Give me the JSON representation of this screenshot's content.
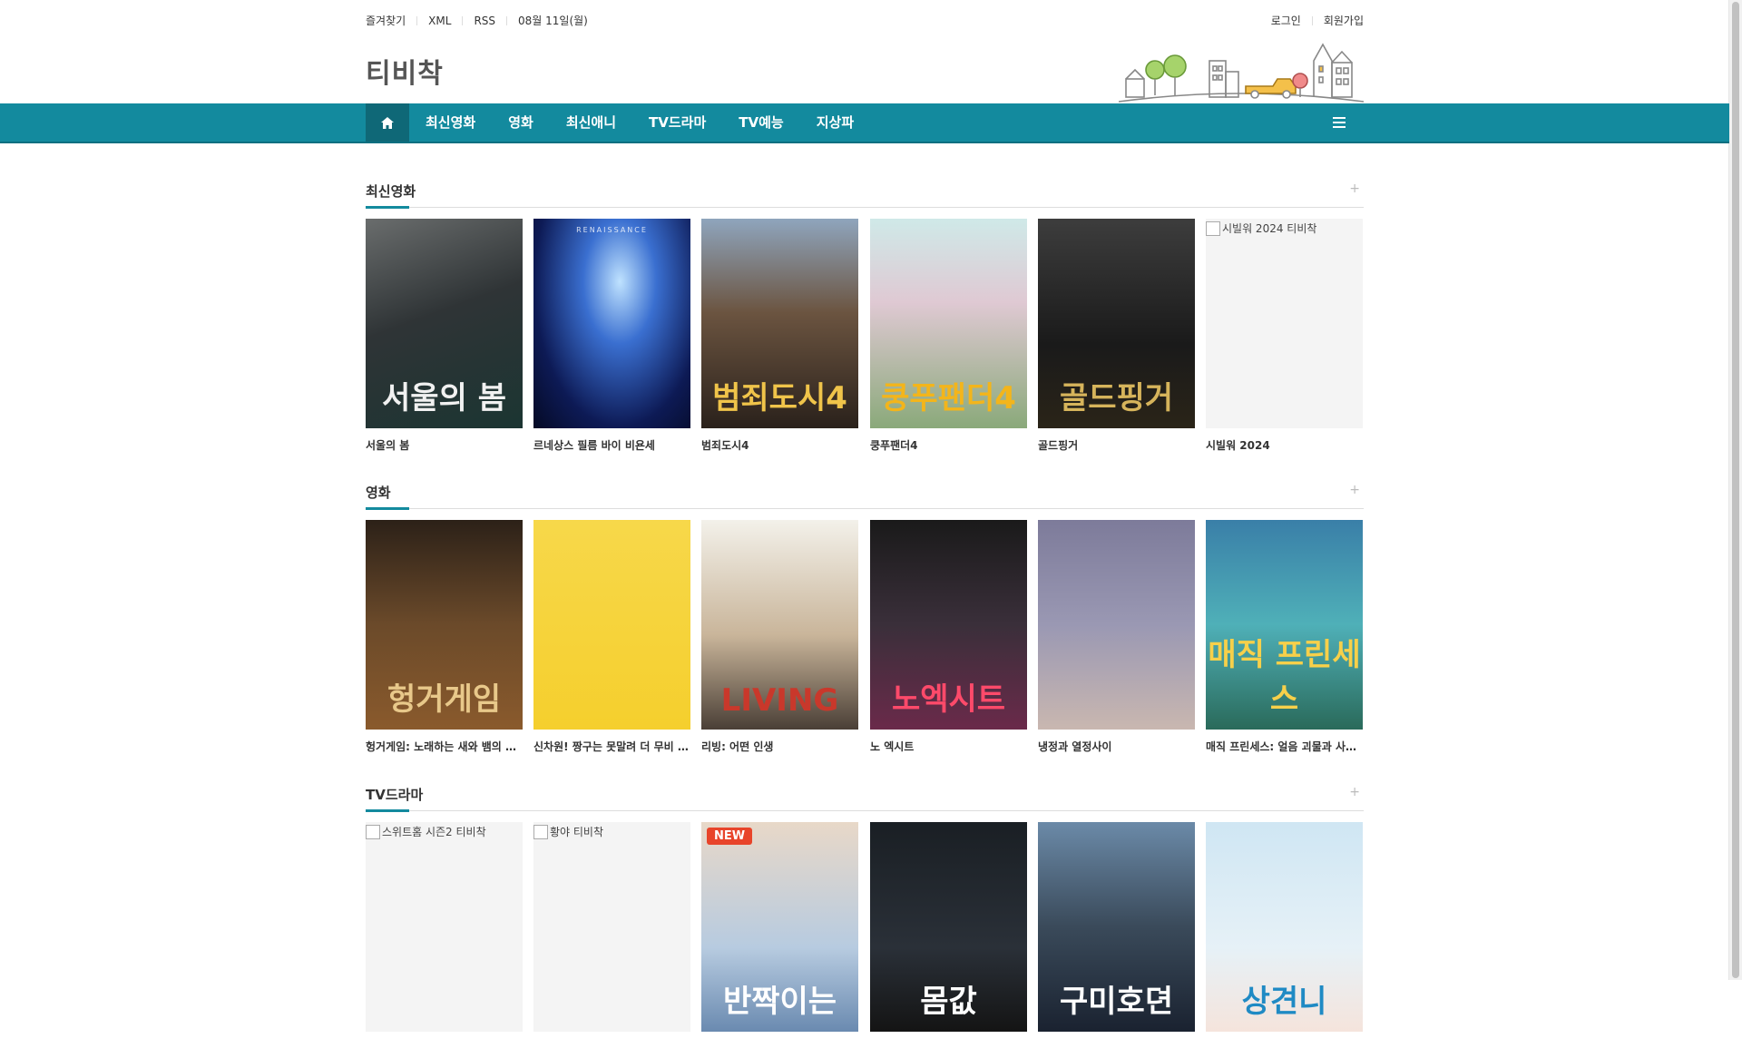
{
  "topbar": {
    "favorites": "즐겨찾기",
    "xml": "XML",
    "rss": "RSS",
    "date": "08월 11일(월)",
    "login": "로그인",
    "signup": "회원가입"
  },
  "site": {
    "logo": "티비착"
  },
  "nav": {
    "items": [
      {
        "label": "최신영화"
      },
      {
        "label": "영화"
      },
      {
        "label": "최신애니"
      },
      {
        "label": "TV드라마"
      },
      {
        "label": "TV예능"
      },
      {
        "label": "지상파"
      }
    ],
    "home_icon": "home-icon",
    "menu_icon": "hamburger-menu-icon"
  },
  "colors": {
    "accent": "#138a9e",
    "accent_dark": "#0f6877"
  },
  "sections": [
    {
      "title": "최신영화",
      "more": "+",
      "cards": [
        {
          "title": "서울의 봄",
          "poster_text": "서울의 봄",
          "alt": "",
          "bg": "linear-gradient(160deg,#6a6d6d 0%,#2f3436 45%,#1b3532 100%)",
          "fg": "#f1f1f1"
        },
        {
          "title": "르네상스 필름 바이 비욘세",
          "poster_text": "",
          "alt": "",
          "bg": "radial-gradient(ellipse at 55% 30%,#bfe2ff 0%,#3a6fd0 30%,#0d1a55 70%,#050a25 100%)",
          "fg": "#fff",
          "tag": "RENAISSANCE"
        },
        {
          "title": "범죄도시4",
          "poster_text": "범죄도시4",
          "alt": "",
          "bg": "linear-gradient(180deg,#8fa5bd 0%,#6b5440 45%,#2a211b 100%)",
          "fg": "#f0c44a"
        },
        {
          "title": "쿵푸팬더4",
          "poster_text": "쿵푸팬더4",
          "alt": "",
          "bg": "linear-gradient(180deg,#cfe9e8 0%,#dfc9d3 40%,#8aa97a 100%)",
          "fg": "#f3b51b"
        },
        {
          "title": "골드핑거",
          "poster_text": "골드핑거",
          "alt": "",
          "bg": "linear-gradient(180deg,#3d3d3d 0%,#1a1a1a 60%,#2a2418 100%)",
          "fg": "#d6b45b"
        },
        {
          "title": "시빌워 2024",
          "poster_text": "",
          "alt": "시빌워 2024 티비착",
          "bg": "#f4f4f4",
          "fg": "#333"
        }
      ]
    },
    {
      "title": "영화",
      "more": "+",
      "cards": [
        {
          "title": "헝거게임: 노래하는 새와 뱀의 발라드",
          "poster_text": "헝거게임",
          "alt": "",
          "bg": "linear-gradient(180deg,#2c2118 0%,#6b4a2a 50%,#8a5a2c 100%)",
          "fg": "#e8c88a"
        },
        {
          "title": "신차원! 짱구는 못말려 더 무비 초능력 대결전",
          "poster_text": "",
          "alt": "",
          "bg": "linear-gradient(180deg,#f7d84a 0%,#f5cf2d 100%)",
          "fg": "#333"
        },
        {
          "title": "리빙: 어떤 인생",
          "poster_text": "LIVING",
          "alt": "",
          "bg": "linear-gradient(180deg,#f3f1ea 0%,#c9b59a 55%,#4a3f36 100%)",
          "fg": "#c9382b"
        },
        {
          "title": "노 엑시트",
          "poster_text": "노엑시트",
          "alt": "",
          "bg": "linear-gradient(180deg,#1a1a1a 0%,#3a2f3a 50%,#6a2a4a 100%)",
          "fg": "#ff4a6a"
        },
        {
          "title": "냉정과 열정사이",
          "poster_text": "",
          "alt": "",
          "bg": "linear-gradient(180deg,#7d7b9a 0%,#9a98b3 50%,#c9b7b0 100%)",
          "fg": "#fff"
        },
        {
          "title": "매직 프린세스: 얼음 괴물과 사라진 연상의 비밀",
          "poster_text": "매직 프린세스",
          "alt": "",
          "bg": "linear-gradient(180deg,#3a7fa8 0%,#4fb0b8 50%,#2a6a5a 100%)",
          "fg": "#f7d04a"
        }
      ]
    },
    {
      "title": "TV드라마",
      "more": "+",
      "cards": [
        {
          "title": "",
          "poster_text": "",
          "alt": "스위트홈 시즌2 티비착",
          "bg": "#f4f4f4",
          "fg": "#333"
        },
        {
          "title": "",
          "poster_text": "",
          "alt": "황야 티비착",
          "bg": "#f4f4f4",
          "fg": "#333"
        },
        {
          "title": "",
          "poster_text": "반짝이는",
          "alt": "",
          "bg": "linear-gradient(180deg,#e8d8c8 0%,#b7cbe0 60%,#6a8ab0 100%)",
          "fg": "#fff",
          "badge": "NEW"
        },
        {
          "title": "",
          "poster_text": "몸값",
          "alt": "",
          "bg": "linear-gradient(180deg,#1a1f24 0%,#2a3038 60%,#141414 100%)",
          "fg": "#fff"
        },
        {
          "title": "",
          "poster_text": "구미호뎐",
          "alt": "",
          "bg": "linear-gradient(180deg,#6b8aa8 0%,#3a4a5a 50%,#1a2230 100%)",
          "fg": "#fff"
        },
        {
          "title": "",
          "poster_text": "상견니",
          "alt": "",
          "bg": "linear-gradient(180deg,#cfe6f3 0%,#e6f1f7 60%,#f5e4dc 100%)",
          "fg": "#1f8ac4"
        }
      ]
    }
  ]
}
